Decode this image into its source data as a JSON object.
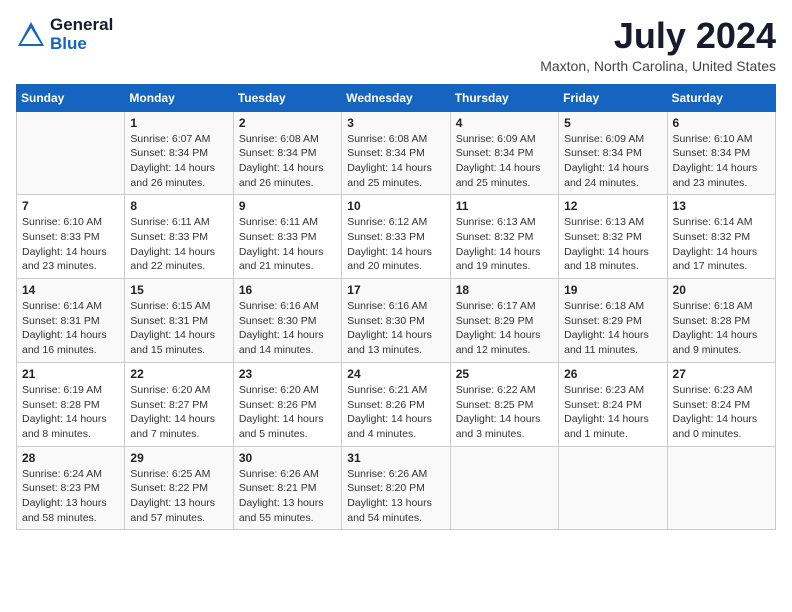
{
  "header": {
    "logo_general": "General",
    "logo_blue": "Blue",
    "month_year": "July 2024",
    "location": "Maxton, North Carolina, United States"
  },
  "days_of_week": [
    "Sunday",
    "Monday",
    "Tuesday",
    "Wednesday",
    "Thursday",
    "Friday",
    "Saturday"
  ],
  "weeks": [
    [
      {
        "day": "",
        "info": ""
      },
      {
        "day": "1",
        "info": "Sunrise: 6:07 AM\nSunset: 8:34 PM\nDaylight: 14 hours\nand 26 minutes."
      },
      {
        "day": "2",
        "info": "Sunrise: 6:08 AM\nSunset: 8:34 PM\nDaylight: 14 hours\nand 26 minutes."
      },
      {
        "day": "3",
        "info": "Sunrise: 6:08 AM\nSunset: 8:34 PM\nDaylight: 14 hours\nand 25 minutes."
      },
      {
        "day": "4",
        "info": "Sunrise: 6:09 AM\nSunset: 8:34 PM\nDaylight: 14 hours\nand 25 minutes."
      },
      {
        "day": "5",
        "info": "Sunrise: 6:09 AM\nSunset: 8:34 PM\nDaylight: 14 hours\nand 24 minutes."
      },
      {
        "day": "6",
        "info": "Sunrise: 6:10 AM\nSunset: 8:34 PM\nDaylight: 14 hours\nand 23 minutes."
      }
    ],
    [
      {
        "day": "7",
        "info": "Sunrise: 6:10 AM\nSunset: 8:33 PM\nDaylight: 14 hours\nand 23 minutes."
      },
      {
        "day": "8",
        "info": "Sunrise: 6:11 AM\nSunset: 8:33 PM\nDaylight: 14 hours\nand 22 minutes."
      },
      {
        "day": "9",
        "info": "Sunrise: 6:11 AM\nSunset: 8:33 PM\nDaylight: 14 hours\nand 21 minutes."
      },
      {
        "day": "10",
        "info": "Sunrise: 6:12 AM\nSunset: 8:33 PM\nDaylight: 14 hours\nand 20 minutes."
      },
      {
        "day": "11",
        "info": "Sunrise: 6:13 AM\nSunset: 8:32 PM\nDaylight: 14 hours\nand 19 minutes."
      },
      {
        "day": "12",
        "info": "Sunrise: 6:13 AM\nSunset: 8:32 PM\nDaylight: 14 hours\nand 18 minutes."
      },
      {
        "day": "13",
        "info": "Sunrise: 6:14 AM\nSunset: 8:32 PM\nDaylight: 14 hours\nand 17 minutes."
      }
    ],
    [
      {
        "day": "14",
        "info": "Sunrise: 6:14 AM\nSunset: 8:31 PM\nDaylight: 14 hours\nand 16 minutes."
      },
      {
        "day": "15",
        "info": "Sunrise: 6:15 AM\nSunset: 8:31 PM\nDaylight: 14 hours\nand 15 minutes."
      },
      {
        "day": "16",
        "info": "Sunrise: 6:16 AM\nSunset: 8:30 PM\nDaylight: 14 hours\nand 14 minutes."
      },
      {
        "day": "17",
        "info": "Sunrise: 6:16 AM\nSunset: 8:30 PM\nDaylight: 14 hours\nand 13 minutes."
      },
      {
        "day": "18",
        "info": "Sunrise: 6:17 AM\nSunset: 8:29 PM\nDaylight: 14 hours\nand 12 minutes."
      },
      {
        "day": "19",
        "info": "Sunrise: 6:18 AM\nSunset: 8:29 PM\nDaylight: 14 hours\nand 11 minutes."
      },
      {
        "day": "20",
        "info": "Sunrise: 6:18 AM\nSunset: 8:28 PM\nDaylight: 14 hours\nand 9 minutes."
      }
    ],
    [
      {
        "day": "21",
        "info": "Sunrise: 6:19 AM\nSunset: 8:28 PM\nDaylight: 14 hours\nand 8 minutes."
      },
      {
        "day": "22",
        "info": "Sunrise: 6:20 AM\nSunset: 8:27 PM\nDaylight: 14 hours\nand 7 minutes."
      },
      {
        "day": "23",
        "info": "Sunrise: 6:20 AM\nSunset: 8:26 PM\nDaylight: 14 hours\nand 5 minutes."
      },
      {
        "day": "24",
        "info": "Sunrise: 6:21 AM\nSunset: 8:26 PM\nDaylight: 14 hours\nand 4 minutes."
      },
      {
        "day": "25",
        "info": "Sunrise: 6:22 AM\nSunset: 8:25 PM\nDaylight: 14 hours\nand 3 minutes."
      },
      {
        "day": "26",
        "info": "Sunrise: 6:23 AM\nSunset: 8:24 PM\nDaylight: 14 hours\nand 1 minute."
      },
      {
        "day": "27",
        "info": "Sunrise: 6:23 AM\nSunset: 8:24 PM\nDaylight: 14 hours\nand 0 minutes."
      }
    ],
    [
      {
        "day": "28",
        "info": "Sunrise: 6:24 AM\nSunset: 8:23 PM\nDaylight: 13 hours\nand 58 minutes."
      },
      {
        "day": "29",
        "info": "Sunrise: 6:25 AM\nSunset: 8:22 PM\nDaylight: 13 hours\nand 57 minutes."
      },
      {
        "day": "30",
        "info": "Sunrise: 6:26 AM\nSunset: 8:21 PM\nDaylight: 13 hours\nand 55 minutes."
      },
      {
        "day": "31",
        "info": "Sunrise: 6:26 AM\nSunset: 8:20 PM\nDaylight: 13 hours\nand 54 minutes."
      },
      {
        "day": "",
        "info": ""
      },
      {
        "day": "",
        "info": ""
      },
      {
        "day": "",
        "info": ""
      }
    ]
  ]
}
